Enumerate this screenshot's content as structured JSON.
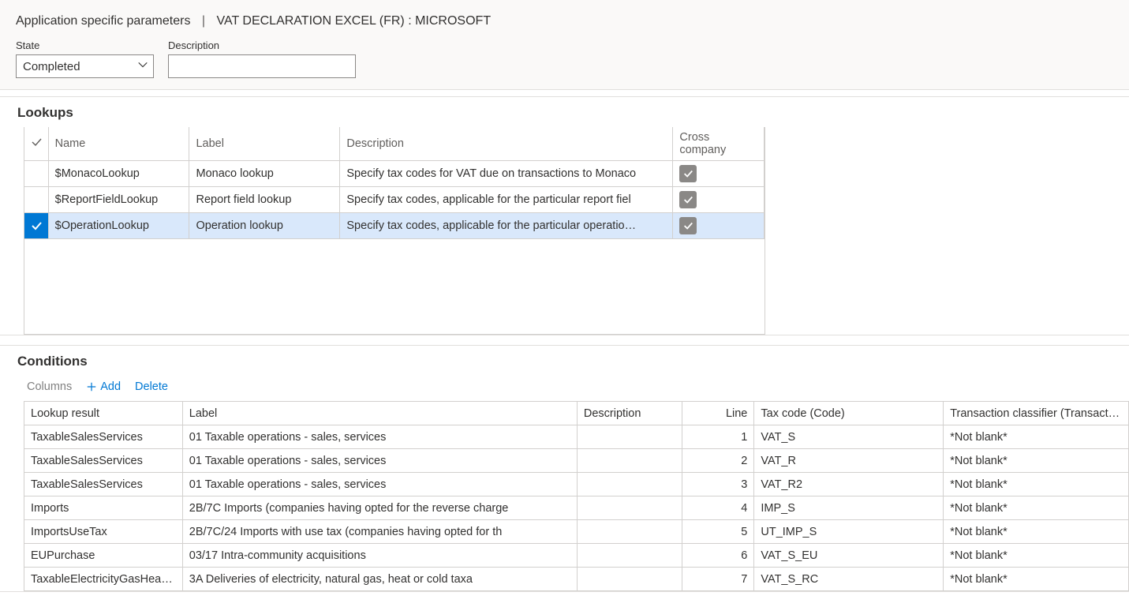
{
  "breadcrumb": {
    "part1": "Application specific parameters",
    "part2": "VAT DECLARATION EXCEL (FR) : MICROSOFT"
  },
  "state": {
    "label": "State",
    "value": "Completed"
  },
  "description": {
    "label": "Description",
    "value": ""
  },
  "lookups": {
    "title": "Lookups",
    "headers": {
      "name": "Name",
      "label": "Label",
      "description": "Description",
      "cc": "Cross company"
    },
    "rows": [
      {
        "selected": false,
        "name": "$MonacoLookup",
        "label": "Monaco lookup",
        "description": "Specify tax codes for VAT due on transactions to Monaco",
        "cc": true
      },
      {
        "selected": false,
        "name": "$ReportFieldLookup",
        "label": "Report field lookup",
        "description": "Specify tax codes, applicable for the particular report fiel",
        "cc": true
      },
      {
        "selected": true,
        "name": "$OperationLookup",
        "label": "Operation lookup",
        "description": "Specify tax codes, applicable for the particular operatio…",
        "cc": true
      }
    ]
  },
  "conditions": {
    "title": "Conditions",
    "toolbar": {
      "columns": "Columns",
      "add": "Add",
      "delete": "Delete"
    },
    "headers": {
      "lookup": "Lookup result",
      "label": "Label",
      "description": "Description",
      "line": "Line",
      "tax": "Tax code (Code)",
      "tc": "Transaction classifier (Transacti…"
    },
    "rows": [
      {
        "lookup": "TaxableSalesServices",
        "label": "01 Taxable operations - sales, services",
        "description": "",
        "line": 1,
        "tax": "VAT_S",
        "tc": "*Not blank*"
      },
      {
        "lookup": "TaxableSalesServices",
        "label": "01 Taxable operations - sales, services",
        "description": "",
        "line": 2,
        "tax": "VAT_R",
        "tc": "*Not blank*"
      },
      {
        "lookup": "TaxableSalesServices",
        "label": "01 Taxable operations - sales, services",
        "description": "",
        "line": 3,
        "tax": "VAT_R2",
        "tc": "*Not blank*"
      },
      {
        "lookup": "Imports",
        "label": "2B/7C Imports (companies having opted for the reverse charge",
        "description": "",
        "line": 4,
        "tax": "IMP_S",
        "tc": "*Not blank*"
      },
      {
        "lookup": "ImportsUseTax",
        "label": "2B/7C/24 Imports with use tax (companies having opted for th",
        "description": "",
        "line": 5,
        "tax": "UT_IMP_S",
        "tc": "*Not blank*"
      },
      {
        "lookup": "EUPurchase",
        "label": "03/17 Intra-community acquisitions",
        "description": "",
        "line": 6,
        "tax": "VAT_S_EU",
        "tc": "*Not blank*"
      },
      {
        "lookup": "TaxableElectricityGasHea…",
        "label": "3A Deliveries of electricity, natural gas, heat or cold taxa",
        "description": "",
        "line": 7,
        "tax": "VAT_S_RC",
        "tc": "*Not blank*"
      }
    ]
  }
}
